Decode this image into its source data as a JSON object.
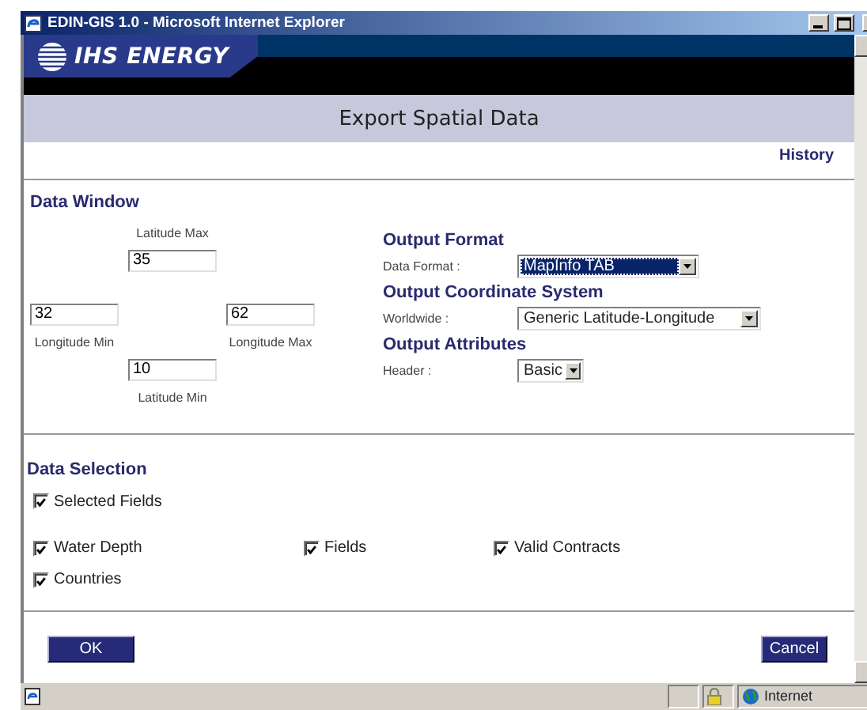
{
  "window": {
    "title": "EDIN-GIS 1.0 - Microsoft Internet Explorer"
  },
  "brand": {
    "name": "IHS ENERGY"
  },
  "page_title": "Export Spatial Data",
  "history_link": "History",
  "data_window": {
    "heading": "Data Window",
    "fields": [
      {
        "label": "Latitude Max",
        "value": "35"
      },
      {
        "label": "Longitude Min",
        "value": "32"
      },
      {
        "label": "Longitude Max",
        "value": "62"
      },
      {
        "label": "Latitude Min",
        "value": "10"
      }
    ]
  },
  "output": [
    {
      "heading": "Output Format",
      "label": "Data Format :",
      "value": "MapInfo TAB",
      "focused": true
    },
    {
      "heading": "Output Coordinate System",
      "label": "Worldwide :",
      "value": "Generic Latitude-Longitude",
      "focused": false
    },
    {
      "heading": "Output Attributes",
      "label": "Header :",
      "value": "Basic",
      "focused": false
    }
  ],
  "data_selection": {
    "heading": "Data Selection",
    "options": [
      {
        "label": "Selected Fields",
        "checked": true
      }
    ],
    "layers": [
      {
        "label": "Water Depth",
        "checked": true
      },
      {
        "label": "Fields",
        "checked": true
      },
      {
        "label": "Valid Contracts",
        "checked": true
      },
      {
        "label": "Countries",
        "checked": true
      }
    ]
  },
  "buttons": [
    {
      "label": "OK"
    },
    {
      "label": "Cancel"
    }
  ],
  "status_bar": {
    "zone": "Internet"
  }
}
